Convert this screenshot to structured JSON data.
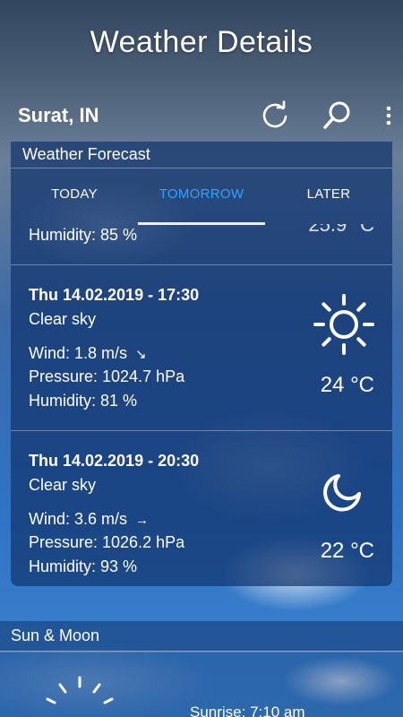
{
  "page_title": "Weather Details",
  "app_bar": {
    "city": "Surat, IN",
    "icons": {
      "refresh": "refresh-icon",
      "search": "search-icon",
      "menu": "more-vert-icon"
    }
  },
  "forecast": {
    "header": "Weather Forecast",
    "tabs": [
      {
        "label": "TODAY",
        "active": false
      },
      {
        "label": "TOMORROW",
        "active": true
      },
      {
        "label": "LATER",
        "active": false
      }
    ],
    "partial_row": {
      "humidity": "Humidity: 85 %",
      "temp_cut": "25.9 °C"
    },
    "items": [
      {
        "datetime": "Thu 14.02.2019 - 17:30",
        "description": "Clear sky",
        "wind": "Wind: 1.8 m/s",
        "wind_arrow": "↘",
        "pressure": "Pressure: 1024.7 hPa",
        "humidity": "Humidity: 81 %",
        "temp": "24 °C",
        "icon": "sun-icon"
      },
      {
        "datetime": "Thu 14.02.2019 - 20:30",
        "description": "Clear sky",
        "wind": "Wind: 3.6 m/s",
        "wind_arrow": "→",
        "pressure": "Pressure: 1026.2 hPa",
        "humidity": "Humidity: 93 %",
        "temp": "22 °C",
        "icon": "moon-icon"
      }
    ]
  },
  "sun_moon": {
    "header": "Sun & Moon",
    "sunrise": "Sunrise: 7:10 am"
  },
  "colors": {
    "tab_active": "#2ea3ff",
    "card_bg": "#12346e"
  }
}
